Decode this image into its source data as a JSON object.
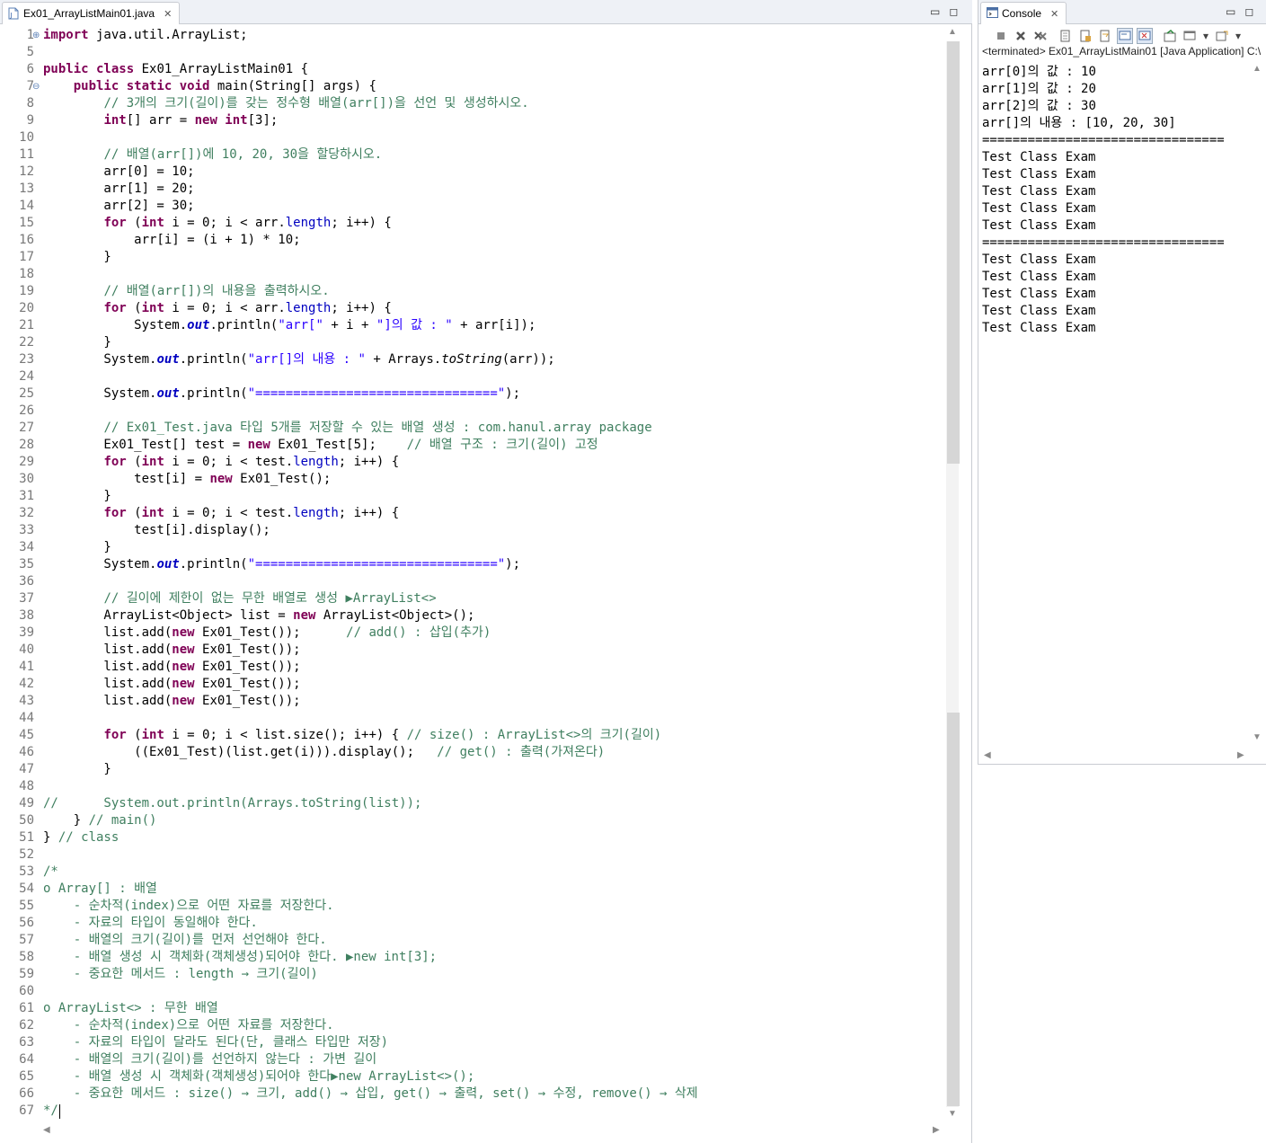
{
  "editor": {
    "tab_title": "Ex01_ArrayListMain01.java",
    "tab_close": "✕",
    "minimize": "▭",
    "maximize": "◻",
    "lines": [
      {
        "n": "1",
        "tokens": [
          {
            "t": "import",
            "c": "kw"
          },
          {
            "t": " java.util.ArrayList;"
          }
        ]
      },
      {
        "n": "5",
        "tokens": []
      },
      {
        "n": "6",
        "tokens": [
          {
            "t": "public class",
            "c": "kw"
          },
          {
            "t": " Ex01_ArrayListMain01 {"
          }
        ]
      },
      {
        "n": "7",
        "tokens": [
          {
            "t": "    "
          },
          {
            "t": "public static void",
            "c": "kw"
          },
          {
            "t": " main(String[] "
          },
          {
            "t": "args",
            "c": "var"
          },
          {
            "t": ") {"
          }
        ]
      },
      {
        "n": "8",
        "tokens": [
          {
            "t": "        "
          },
          {
            "t": "// 3개의 크기(길이)를 갖는 정수형 배열(arr[])을 선언 및 생성하시오.",
            "c": "cm"
          }
        ]
      },
      {
        "n": "9",
        "tokens": [
          {
            "t": "        "
          },
          {
            "t": "int",
            "c": "kw"
          },
          {
            "t": "[] arr = "
          },
          {
            "t": "new int",
            "c": "kw"
          },
          {
            "t": "[3];"
          }
        ]
      },
      {
        "n": "10",
        "tokens": []
      },
      {
        "n": "11",
        "tokens": [
          {
            "t": "        "
          },
          {
            "t": "// 배열(arr[])에 10, 20, 30을 할당하시오.",
            "c": "cm"
          }
        ]
      },
      {
        "n": "12",
        "tokens": [
          {
            "t": "        arr[0] = 10;"
          }
        ]
      },
      {
        "n": "13",
        "tokens": [
          {
            "t": "        arr[1] = 20;"
          }
        ]
      },
      {
        "n": "14",
        "tokens": [
          {
            "t": "        arr[2] = 30;"
          }
        ]
      },
      {
        "n": "15",
        "tokens": [
          {
            "t": "        "
          },
          {
            "t": "for",
            "c": "kw"
          },
          {
            "t": " ("
          },
          {
            "t": "int",
            "c": "kw"
          },
          {
            "t": " i = 0; i < arr."
          },
          {
            "t": "length",
            "c": "fieldref"
          },
          {
            "t": "; i++) {"
          }
        ]
      },
      {
        "n": "16",
        "tokens": [
          {
            "t": "            arr[i] = (i + 1) * 10;"
          }
        ]
      },
      {
        "n": "17",
        "tokens": [
          {
            "t": "        }"
          }
        ]
      },
      {
        "n": "18",
        "tokens": []
      },
      {
        "n": "19",
        "tokens": [
          {
            "t": "        "
          },
          {
            "t": "// 배열(arr[])의 내용을 출력하시오.",
            "c": "cm"
          }
        ]
      },
      {
        "n": "20",
        "tokens": [
          {
            "t": "        "
          },
          {
            "t": "for",
            "c": "kw"
          },
          {
            "t": " ("
          },
          {
            "t": "int",
            "c": "kw"
          },
          {
            "t": " i = 0; i < arr."
          },
          {
            "t": "length",
            "c": "fieldref"
          },
          {
            "t": "; i++) {"
          }
        ]
      },
      {
        "n": "21",
        "tokens": [
          {
            "t": "            System."
          },
          {
            "t": "out",
            "c": "fld"
          },
          {
            "t": ".println("
          },
          {
            "t": "\"arr[\"",
            "c": "st"
          },
          {
            "t": " + i + "
          },
          {
            "t": "\"]의 값 : \"",
            "c": "st"
          },
          {
            "t": " + arr[i]);"
          }
        ]
      },
      {
        "n": "22",
        "tokens": [
          {
            "t": "        }"
          }
        ]
      },
      {
        "n": "23",
        "tokens": [
          {
            "t": "        System."
          },
          {
            "t": "out",
            "c": "fld"
          },
          {
            "t": ".println("
          },
          {
            "t": "\"arr[]의 내용 : \"",
            "c": "st"
          },
          {
            "t": " + Arrays."
          },
          {
            "t": "toString",
            "c": "ital"
          },
          {
            "t": "(arr));"
          }
        ]
      },
      {
        "n": "24",
        "tokens": []
      },
      {
        "n": "25",
        "tokens": [
          {
            "t": "        System."
          },
          {
            "t": "out",
            "c": "fld"
          },
          {
            "t": ".println("
          },
          {
            "t": "\"================================\"",
            "c": "st"
          },
          {
            "t": ");"
          }
        ]
      },
      {
        "n": "26",
        "tokens": []
      },
      {
        "n": "27",
        "tokens": [
          {
            "t": "        "
          },
          {
            "t": "// Ex01_Test.java 타입 5개를 저장할 수 있는 배열 생성 : com.hanul.array package",
            "c": "cm"
          }
        ]
      },
      {
        "n": "28",
        "tokens": [
          {
            "t": "        Ex01_Test[] test = "
          },
          {
            "t": "new",
            "c": "kw"
          },
          {
            "t": " Ex01_Test[5];    "
          },
          {
            "t": "// 배열 구조 : 크기(길이) 고정",
            "c": "cm"
          }
        ]
      },
      {
        "n": "29",
        "tokens": [
          {
            "t": "        "
          },
          {
            "t": "for",
            "c": "kw"
          },
          {
            "t": " ("
          },
          {
            "t": "int",
            "c": "kw"
          },
          {
            "t": " i = 0; i < test."
          },
          {
            "t": "length",
            "c": "fieldref"
          },
          {
            "t": "; i++) {"
          }
        ]
      },
      {
        "n": "30",
        "tokens": [
          {
            "t": "            test[i] = "
          },
          {
            "t": "new",
            "c": "kw"
          },
          {
            "t": " Ex01_Test();"
          }
        ]
      },
      {
        "n": "31",
        "tokens": [
          {
            "t": "        }"
          }
        ]
      },
      {
        "n": "32",
        "tokens": [
          {
            "t": "        "
          },
          {
            "t": "for",
            "c": "kw"
          },
          {
            "t": " ("
          },
          {
            "t": "int",
            "c": "kw"
          },
          {
            "t": " i = 0; i < test."
          },
          {
            "t": "length",
            "c": "fieldref"
          },
          {
            "t": "; i++) {"
          }
        ]
      },
      {
        "n": "33",
        "tokens": [
          {
            "t": "            test[i].display();"
          }
        ]
      },
      {
        "n": "34",
        "tokens": [
          {
            "t": "        }"
          }
        ]
      },
      {
        "n": "35",
        "tokens": [
          {
            "t": "        System."
          },
          {
            "t": "out",
            "c": "fld"
          },
          {
            "t": ".println("
          },
          {
            "t": "\"================================\"",
            "c": "st"
          },
          {
            "t": ");"
          }
        ]
      },
      {
        "n": "36",
        "tokens": []
      },
      {
        "n": "37",
        "tokens": [
          {
            "t": "        "
          },
          {
            "t": "// 길이에 제한이 없는 무한 배열로 생성 ▶ArrayList<>",
            "c": "cm"
          }
        ]
      },
      {
        "n": "38",
        "tokens": [
          {
            "t": "        ArrayList<Object> list = "
          },
          {
            "t": "new",
            "c": "kw"
          },
          {
            "t": " ArrayList<Object>();"
          }
        ]
      },
      {
        "n": "39",
        "tokens": [
          {
            "t": "        list.add("
          },
          {
            "t": "new",
            "c": "kw"
          },
          {
            "t": " Ex01_Test());      "
          },
          {
            "t": "// add() : 삽입(추가)",
            "c": "cm"
          }
        ]
      },
      {
        "n": "40",
        "tokens": [
          {
            "t": "        list.add("
          },
          {
            "t": "new",
            "c": "kw"
          },
          {
            "t": " Ex01_Test());"
          }
        ]
      },
      {
        "n": "41",
        "tokens": [
          {
            "t": "        list.add("
          },
          {
            "t": "new",
            "c": "kw"
          },
          {
            "t": " Ex01_Test());"
          }
        ]
      },
      {
        "n": "42",
        "tokens": [
          {
            "t": "        list.add("
          },
          {
            "t": "new",
            "c": "kw"
          },
          {
            "t": " Ex01_Test());"
          }
        ]
      },
      {
        "n": "43",
        "tokens": [
          {
            "t": "        list.add("
          },
          {
            "t": "new",
            "c": "kw"
          },
          {
            "t": " Ex01_Test());"
          }
        ]
      },
      {
        "n": "44",
        "tokens": []
      },
      {
        "n": "45",
        "tokens": [
          {
            "t": "        "
          },
          {
            "t": "for",
            "c": "kw"
          },
          {
            "t": " ("
          },
          {
            "t": "int",
            "c": "kw"
          },
          {
            "t": " i = 0; i < list.size(); i++) { "
          },
          {
            "t": "// size() : ArrayList<>의 크기(길이)",
            "c": "cm"
          }
        ]
      },
      {
        "n": "46",
        "tokens": [
          {
            "t": "            ((Ex01_Test)(list.get(i))).display();   "
          },
          {
            "t": "// get() : 출력(가져온다)",
            "c": "cm"
          }
        ]
      },
      {
        "n": "47",
        "tokens": [
          {
            "t": "        }"
          }
        ]
      },
      {
        "n": "48",
        "tokens": []
      },
      {
        "n": "49",
        "tokens": [
          {
            "t": "//      System.out.println(Arrays.toString(list));",
            "c": "cm"
          }
        ]
      },
      {
        "n": "50",
        "tokens": [
          {
            "t": "    } "
          },
          {
            "t": "// main()",
            "c": "cm"
          }
        ]
      },
      {
        "n": "51",
        "tokens": [
          {
            "t": "} "
          },
          {
            "t": "// class",
            "c": "cm"
          }
        ]
      },
      {
        "n": "52",
        "tokens": []
      },
      {
        "n": "53",
        "tokens": [
          {
            "t": "/*",
            "c": "cm"
          }
        ]
      },
      {
        "n": "54",
        "tokens": [
          {
            "t": "o Array[] : 배열",
            "c": "cm"
          }
        ]
      },
      {
        "n": "55",
        "tokens": [
          {
            "t": "    - 순차적(index)으로 어떤 자료를 저장한다.",
            "c": "cm"
          }
        ]
      },
      {
        "n": "56",
        "tokens": [
          {
            "t": "    - 자료의 타입이 동일해야 한다.",
            "c": "cm"
          }
        ]
      },
      {
        "n": "57",
        "tokens": [
          {
            "t": "    - 배열의 크기(길이)를 먼저 선언해야 한다.",
            "c": "cm"
          }
        ]
      },
      {
        "n": "58",
        "tokens": [
          {
            "t": "    - 배열 생성 시 객체화(객체생성)되어야 한다. ▶new int[3];",
            "c": "cm"
          }
        ]
      },
      {
        "n": "59",
        "tokens": [
          {
            "t": "    - 중요한 메서드 : length → 크기(길이)",
            "c": "cm"
          }
        ]
      },
      {
        "n": "60",
        "tokens": []
      },
      {
        "n": "61",
        "tokens": [
          {
            "t": "o ArrayList<> : 무한 배열",
            "c": "cm"
          }
        ]
      },
      {
        "n": "62",
        "tokens": [
          {
            "t": "    - 순차적(index)으로 어떤 자료를 저장한다.",
            "c": "cm"
          }
        ]
      },
      {
        "n": "63",
        "tokens": [
          {
            "t": "    - 자료의 타입이 달라도 된다(단, 클래스 타입만 저장)",
            "c": "cm"
          }
        ]
      },
      {
        "n": "64",
        "tokens": [
          {
            "t": "    - 배열의 크기(길이)를 선언하지 않는다 : 가변 길이",
            "c": "cm"
          }
        ]
      },
      {
        "n": "65",
        "tokens": [
          {
            "t": "    - 배열 생성 시 객체화(객체생성)되어야 한다▶new ArrayList<>();",
            "c": "cm"
          }
        ]
      },
      {
        "n": "66",
        "tokens": [
          {
            "t": "    - 중요한 메서드 : size() → 크기, add() → 삽입, get() → 출력, set() → 수정, remove() → 삭제",
            "c": "cm"
          }
        ]
      },
      {
        "n": "67",
        "tokens": [
          {
            "t": "*/",
            "c": "cm"
          }
        ]
      }
    ]
  },
  "console": {
    "tab_title": "Console",
    "tab_close": "✕",
    "minimize": "▭",
    "maximize": "◻",
    "status": "<terminated> Ex01_ArrayListMain01 [Java Application] C:\\",
    "output": [
      "arr[0]의 값 : 10",
      "arr[1]의 값 : 20",
      "arr[2]의 값 : 30",
      "arr[]의 내용 : [10, 20, 30]",
      "================================",
      "Test Class Exam",
      "Test Class Exam",
      "Test Class Exam",
      "Test Class Exam",
      "Test Class Exam",
      "================================",
      "Test Class Exam",
      "Test Class Exam",
      "Test Class Exam",
      "Test Class Exam",
      "Test Class Exam"
    ]
  }
}
